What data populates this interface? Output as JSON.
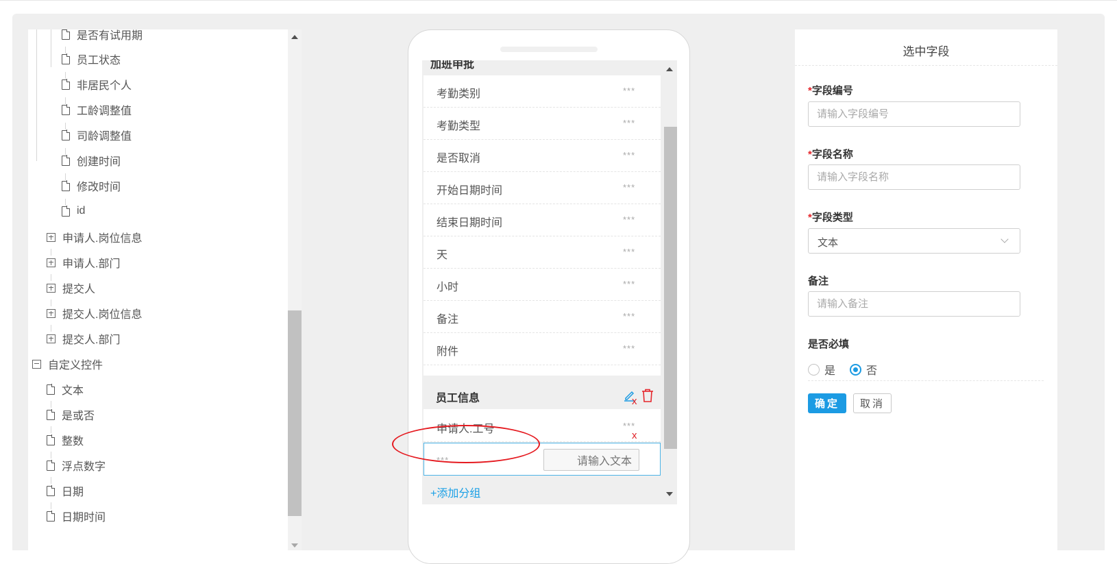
{
  "tree": {
    "items": [
      {
        "label": "是否有试用期",
        "icon": "file-icon"
      },
      {
        "label": "员工状态",
        "icon": "file-icon"
      },
      {
        "label": "非居民个人",
        "icon": "file-icon"
      },
      {
        "label": "工龄调整值",
        "icon": "file-icon"
      },
      {
        "label": "司龄调整值",
        "icon": "file-icon"
      },
      {
        "label": "创建时间",
        "icon": "file-icon"
      },
      {
        "label": "修改时间",
        "icon": "file-icon"
      },
      {
        "label": "id",
        "icon": "file-icon"
      },
      {
        "label": "申请人.岗位信息",
        "icon": "expand-plus-icon"
      },
      {
        "label": "申请人.部门",
        "icon": "expand-plus-icon"
      },
      {
        "label": "提交人",
        "icon": "expand-plus-icon"
      },
      {
        "label": "提交人.岗位信息",
        "icon": "expand-plus-icon"
      },
      {
        "label": "提交人.部门",
        "icon": "expand-plus-icon"
      },
      {
        "label": "自定义控件",
        "icon": "collapse-minus-icon"
      },
      {
        "label": "文本",
        "icon": "file-icon"
      },
      {
        "label": "是或否",
        "icon": "file-icon"
      },
      {
        "label": "整数",
        "icon": "file-icon"
      },
      {
        "label": "浮点数字",
        "icon": "file-icon"
      },
      {
        "label": "日期",
        "icon": "file-icon"
      },
      {
        "label": "日期时间",
        "icon": "file-icon"
      }
    ]
  },
  "phone": {
    "group1": {
      "title": "加班申批",
      "rows": [
        {
          "label": "考勤类别",
          "value": "***"
        },
        {
          "label": "考勤类型",
          "value": "***"
        },
        {
          "label": "是否取消",
          "value": "***"
        },
        {
          "label": "开始日期时间",
          "value": "***"
        },
        {
          "label": "结束日期时间",
          "value": "***"
        },
        {
          "label": "天",
          "value": "***"
        },
        {
          "label": "小时",
          "value": "***"
        },
        {
          "label": "备注",
          "value": "***"
        },
        {
          "label": "附件",
          "value": "***"
        }
      ]
    },
    "group2": {
      "title": "员工信息",
      "field1": {
        "label": "申请人.工号",
        "value": "***"
      },
      "field_new": {
        "value": "***",
        "text_placeholder": "请输入文本"
      },
      "remove_glyph": "x"
    },
    "add_group_label": "+添加分组"
  },
  "config": {
    "title": "选中字段",
    "field_code": {
      "required_mark": "*",
      "label": "字段编号",
      "placeholder": "请输入字段编号"
    },
    "field_name": {
      "required_mark": "*",
      "label": "字段名称",
      "placeholder": "请输入字段名称"
    },
    "field_type": {
      "required_mark": "*",
      "label": "字段类型",
      "selected": "文本"
    },
    "remark": {
      "label": "备注",
      "placeholder": "请输入备注"
    },
    "required": {
      "label": "是否必填",
      "options": [
        "是",
        "否"
      ],
      "selected": "否"
    },
    "ok_label": "确定",
    "cancel_label": "取消"
  },
  "colors": {
    "accent": "#1c9be3",
    "danger": "#e5262c",
    "annotation": "#e51a20"
  }
}
